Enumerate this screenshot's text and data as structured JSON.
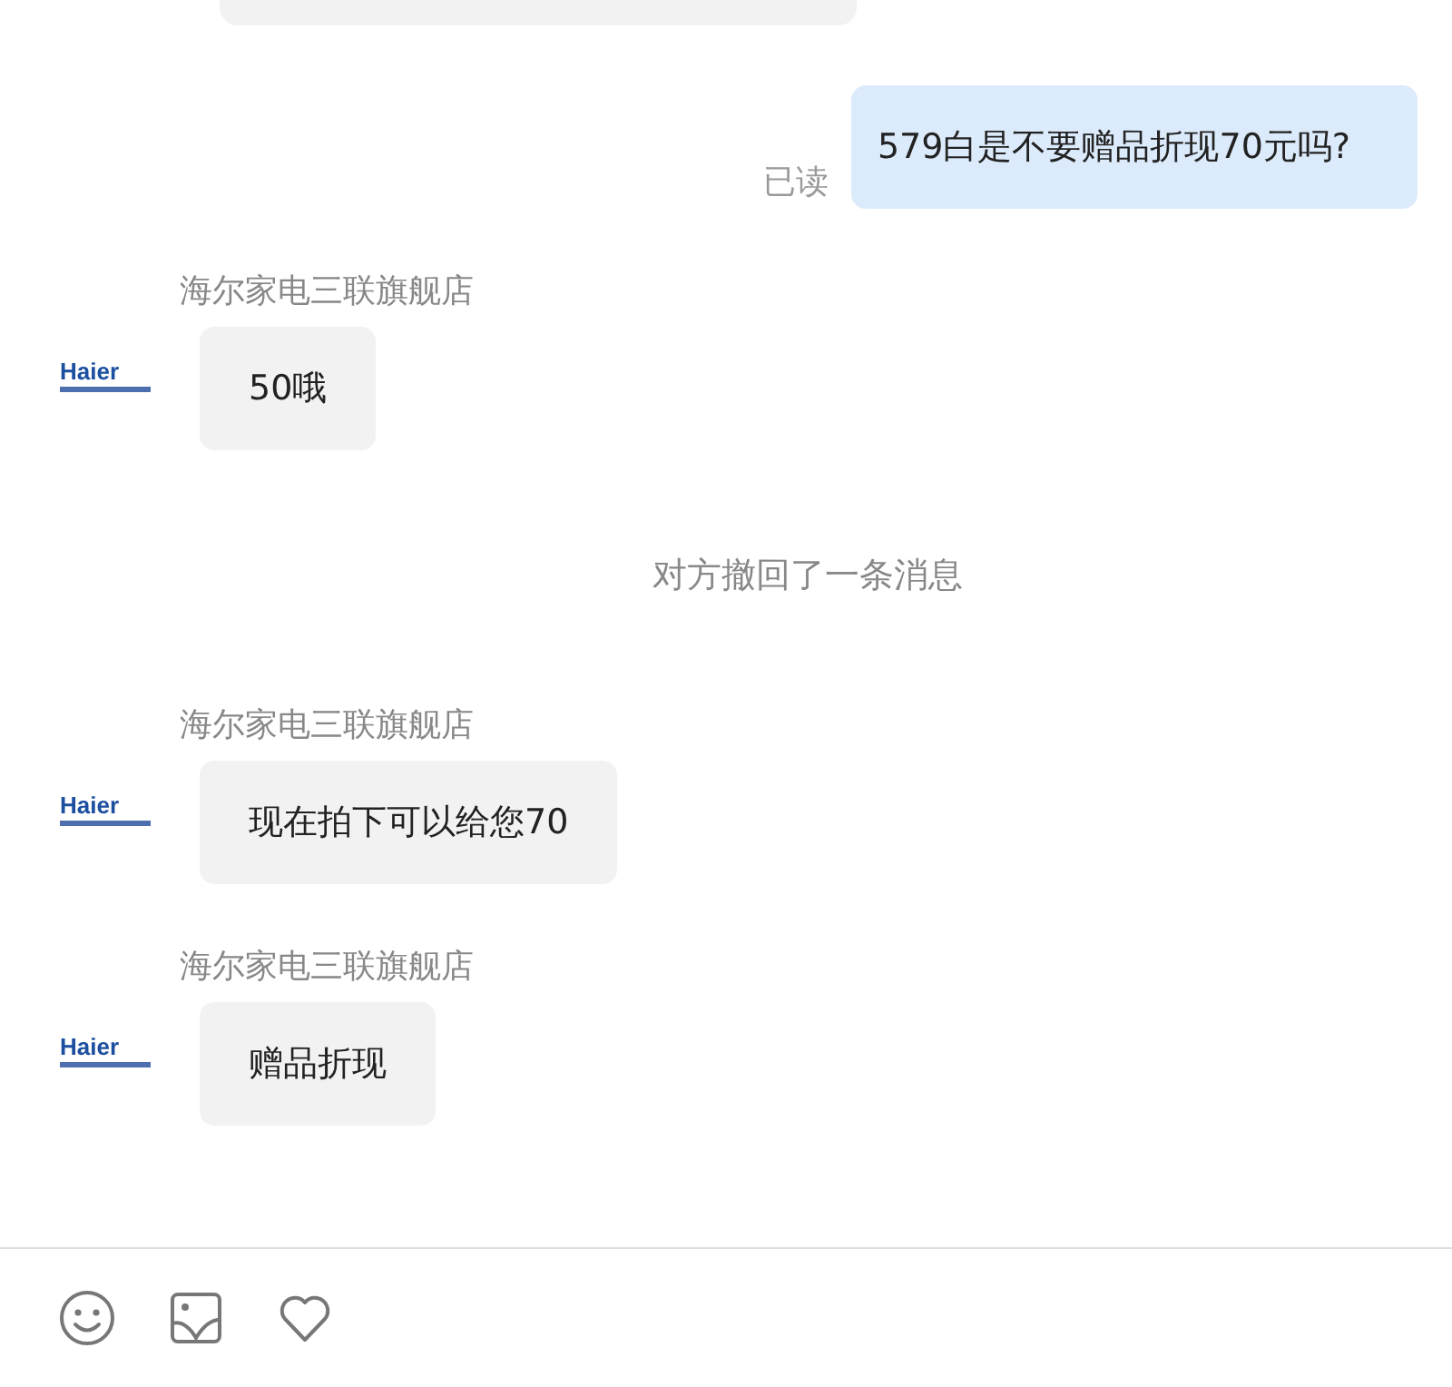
{
  "messages": [
    {
      "kind": "partial"
    },
    {
      "kind": "outgoing",
      "text": "579白是不要赠品折现70元吗?",
      "receipt": "已读"
    },
    {
      "kind": "incoming",
      "sender": "海尔家电三联旗舰店",
      "avatar": "Haier",
      "text": "50哦"
    },
    {
      "kind": "notice",
      "text": "对方撤回了一条消息"
    },
    {
      "kind": "incoming",
      "sender": "海尔家电三联旗舰店",
      "avatar": "Haier",
      "text": "现在拍下可以给您70"
    },
    {
      "kind": "incoming",
      "sender": "海尔家电三联旗舰店",
      "avatar": "Haier",
      "text": "赠品折现"
    }
  ],
  "toolbar": [
    {
      "kind": "emoji"
    },
    {
      "kind": "image"
    },
    {
      "kind": "like"
    }
  ]
}
